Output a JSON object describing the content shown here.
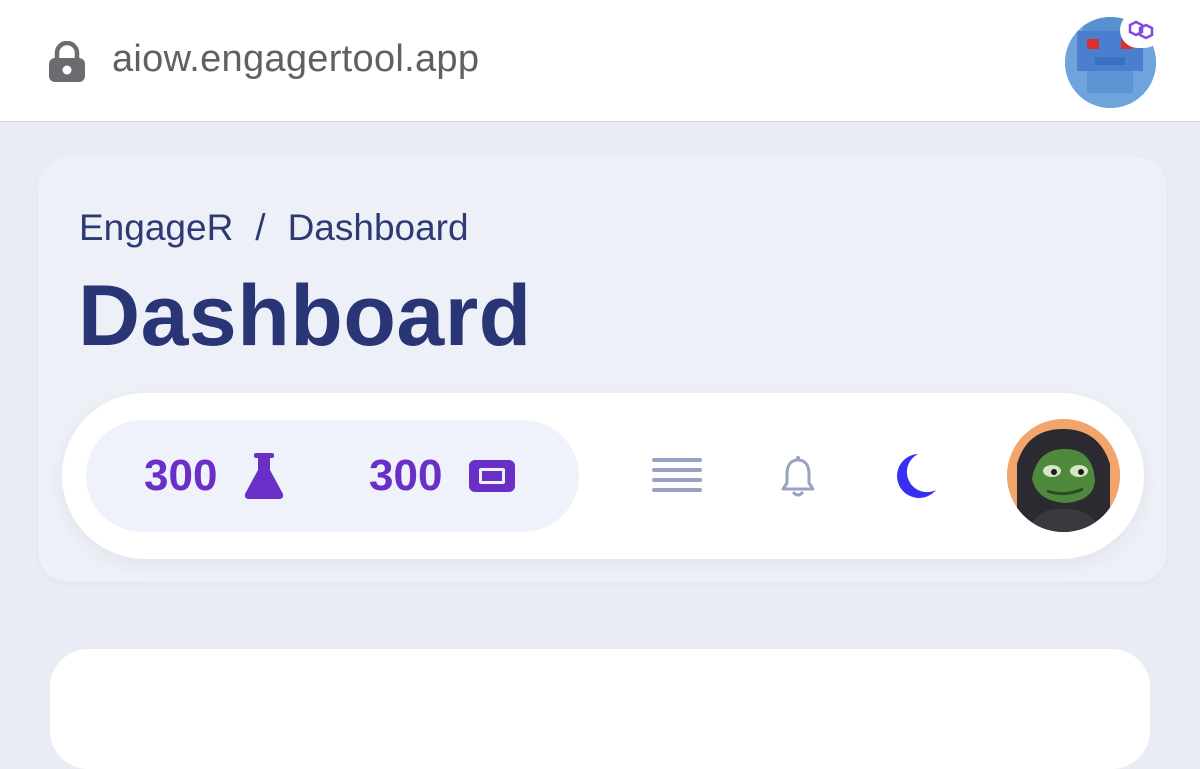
{
  "browser": {
    "url": "aiow.engagertool.app"
  },
  "header": {
    "breadcrumb": {
      "root": "EngageR",
      "separator": "/",
      "current": "Dashboard"
    },
    "title": "Dashboard"
  },
  "navbar": {
    "balances": [
      {
        "value": "300",
        "icon": "flask-icon"
      },
      {
        "value": "300",
        "icon": "ticket-icon"
      }
    ],
    "icons": [
      "menu-icon",
      "bell-icon",
      "moon-icon"
    ]
  },
  "colors": {
    "accent_purple": "#6a2fc6",
    "title_navy": "#2a3576",
    "moon_blue": "#3a2ff0",
    "icon_gray": "#9aa2c3"
  }
}
